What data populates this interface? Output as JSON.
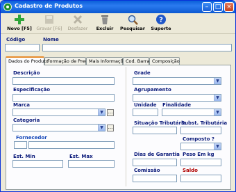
{
  "window": {
    "title": "Cadastro de Produtos"
  },
  "toolbar": {
    "novo": "Novo [F5]",
    "gravar": "Gravar [F6]",
    "desfazer": "Desfazer",
    "excluir": "Excluir",
    "pesquisar": "Pesquisar",
    "suporte": "Suporte"
  },
  "header": {
    "codigo_label": "Código",
    "nome_label": "Nome"
  },
  "tabs": [
    {
      "label": "Dados do Produto"
    },
    {
      "label": "Formação de Preço"
    },
    {
      "label": "Mais Informações"
    },
    {
      "label": "Cod. Barras"
    },
    {
      "label": "Composição"
    }
  ],
  "left": {
    "descricao": "Descrição",
    "especificacao": "Especificação",
    "marca": "Marca",
    "categoria": "Categoria",
    "fornecedor": "Fornecedor",
    "est_min": "Est. Min",
    "est_max": "Est. Max"
  },
  "right": {
    "grade": "Grade",
    "agrupamento": "Agrupamento",
    "unidade": "Unidade",
    "finalidade": "Finalidade",
    "situacao": "Situação Tributária",
    "subst": "Subst. Tributária",
    "composto": "Composto ?",
    "dias_garantia": "Dias de Garantia",
    "peso": "Peso Em kg",
    "comissao": "Comissão",
    "saldo": "Saldo"
  },
  "colors": {
    "accent_tab": "#e68b2c",
    "label": "#0a1a7a",
    "saldo": "#b00000"
  }
}
